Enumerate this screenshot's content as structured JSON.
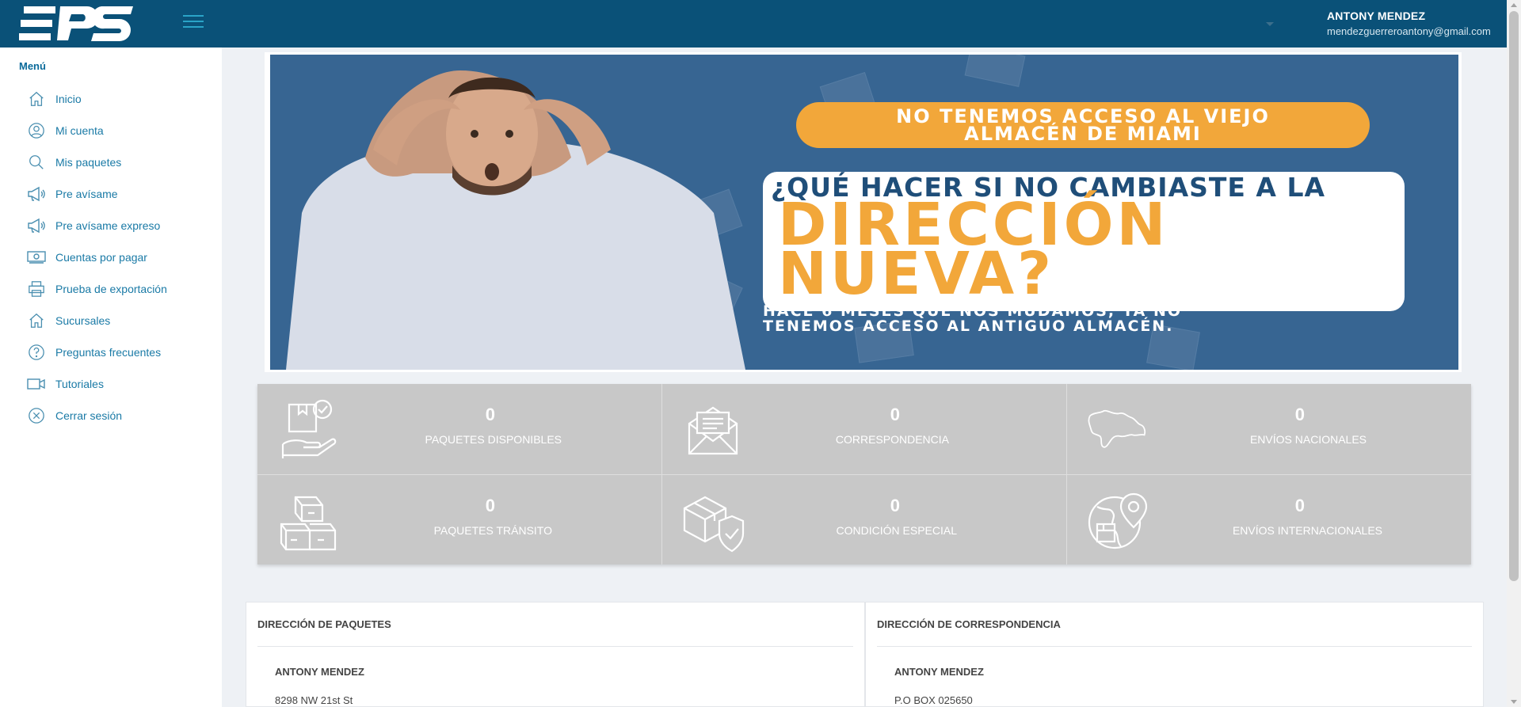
{
  "header": {
    "logo_text": "EPS",
    "user_name": "ANTONY MENDEZ",
    "user_email": "mendezguerreroantony@gmail.com"
  },
  "sidebar": {
    "title": "Menú",
    "items": [
      {
        "label": "Inicio",
        "icon": "home-icon"
      },
      {
        "label": "Mi cuenta",
        "icon": "user-icon"
      },
      {
        "label": "Mis paquetes",
        "icon": "search-icon"
      },
      {
        "label": "Pre avísame",
        "icon": "megaphone-icon"
      },
      {
        "label": "Pre avísame expreso",
        "icon": "megaphone-icon"
      },
      {
        "label": "Cuentas por pagar",
        "icon": "money-icon"
      },
      {
        "label": "Prueba de exportación",
        "icon": "printer-icon"
      },
      {
        "label": "Sucursales",
        "icon": "home-icon"
      },
      {
        "label": "Preguntas frecuentes",
        "icon": "help-icon"
      },
      {
        "label": "Tutoriales",
        "icon": "video-icon"
      },
      {
        "label": "Cerrar sesión",
        "icon": "close-circle-icon"
      }
    ]
  },
  "banner": {
    "pill_line1": "NO TENEMOS ACCESO AL VIEJO",
    "pill_line2": "ALMACÉN DE MIAMI",
    "headline1": "¿QUÉ HACER SI NO CAMBIASTE A LA",
    "headline2": "DIRECCIÓN",
    "headline3": "NUEVA?",
    "sub1": "HACE 6 MESES QUE NOS MUDAMOS, YA NO",
    "sub2": "TENEMOS ACCESO AL ANTIGUO ALMACÉN."
  },
  "stats": [
    {
      "count": "0",
      "label": "PAQUETES DISPONIBLES",
      "icon": "package-hand-icon"
    },
    {
      "count": "0",
      "label": "CORRESPONDENCIA",
      "icon": "envelope-icon"
    },
    {
      "count": "0",
      "label": "ENVÍOS NACIONALES",
      "icon": "map-icon"
    },
    {
      "count": "0",
      "label": "PAQUETES TRÁNSITO",
      "icon": "boxes-icon"
    },
    {
      "count": "0",
      "label": "CONDICIÓN ESPECIAL",
      "icon": "box-shield-icon"
    },
    {
      "count": "0",
      "label": "ENVÍOS INTERNACIONALES",
      "icon": "globe-pin-icon"
    }
  ],
  "addresses": {
    "packages": {
      "title": "DIRECCIÓN DE PAQUETES",
      "name": "ANTONY MENDEZ",
      "line1": "8298 NW 21st St"
    },
    "mail": {
      "title": "DIRECCIÓN DE CORRESPONDENCIA",
      "name": "ANTONY MENDEZ",
      "line1": "P.O BOX 025650"
    }
  },
  "colors": {
    "header": "#0a5178",
    "accent": "#1a7aa6",
    "banner_bg": "#376592",
    "orange": "#f2a73a",
    "stats_bg": "#c8c8c8"
  }
}
